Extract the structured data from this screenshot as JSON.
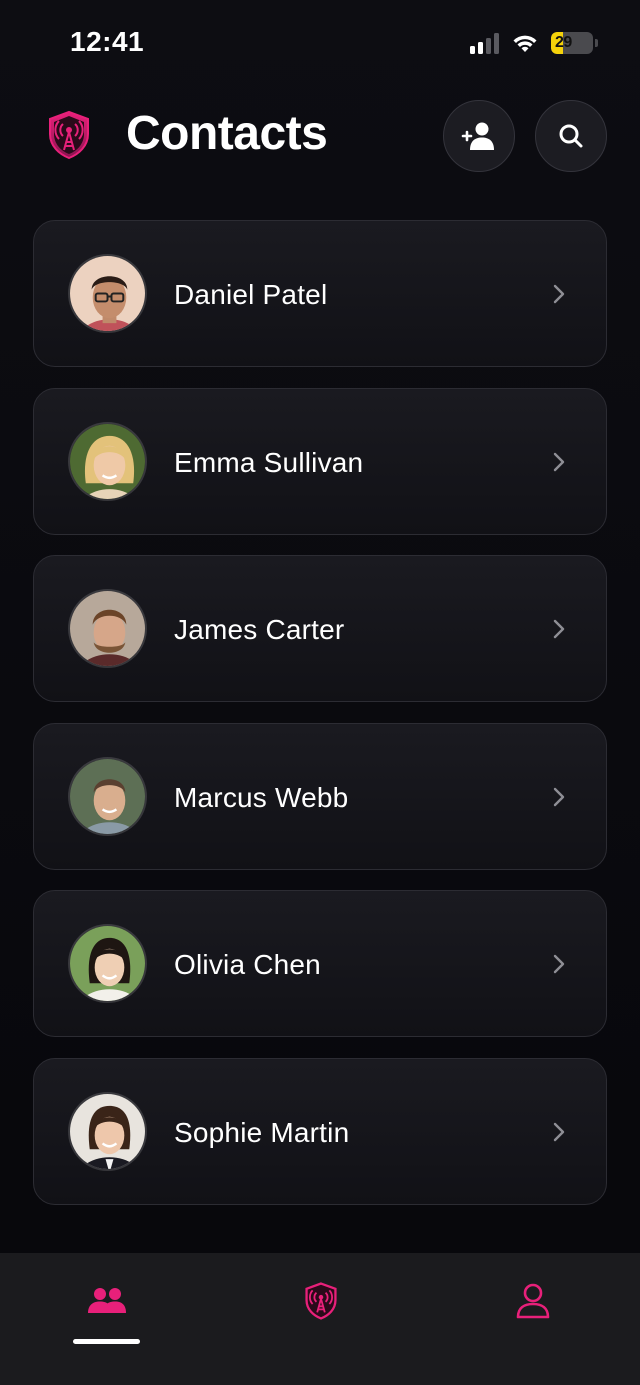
{
  "status_bar": {
    "time": "12:41",
    "battery_percent": "29",
    "battery_level": 0.29
  },
  "header": {
    "title": "Contacts",
    "add_icon": "add-person-icon",
    "search_icon": "search-icon",
    "logo_icon": "shield-antenna-icon"
  },
  "contacts": [
    {
      "name": "Daniel Patel"
    },
    {
      "name": "Emma Sullivan"
    },
    {
      "name": "James Carter"
    },
    {
      "name": "Marcus Webb"
    },
    {
      "name": "Olivia Chen"
    },
    {
      "name": "Sophie Martin"
    }
  ],
  "tab_bar": {
    "tabs": [
      {
        "icon": "people-icon",
        "active": true
      },
      {
        "icon": "shield-antenna-icon",
        "active": false
      },
      {
        "icon": "person-icon",
        "active": false
      }
    ]
  },
  "colors": {
    "accent": "#e8207a",
    "background": "#0a0a0f",
    "card": "#15151b",
    "card_border": "#2c2c33",
    "battery": "#f5d20a"
  }
}
